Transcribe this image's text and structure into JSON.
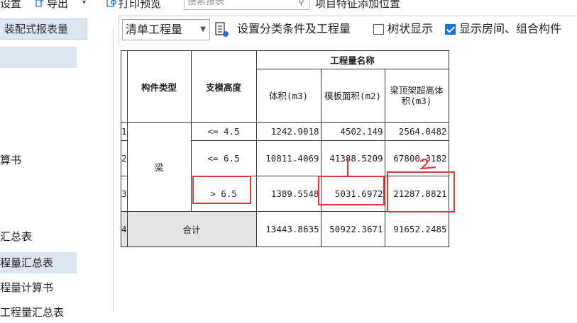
{
  "topbar": {
    "settings": "设置",
    "export": "导出",
    "print_preview": "打印预览",
    "search_placeholder": "搜索报表",
    "add_position": "项目特征添加位置"
  },
  "sidebar": {
    "tab_label": "装配式报表量",
    "items": [
      {
        "label": "算书"
      },
      {
        "label": "汇总表"
      },
      {
        "label": "程量汇总表"
      },
      {
        "label": "程量计算书"
      },
      {
        "label": "工程量汇总表"
      }
    ]
  },
  "toolbar": {
    "dropdown_value": "清单工程量",
    "set_classify": "设置分类条件及工程量",
    "tree_display": "树状显示",
    "tree_display_checked": false,
    "show_rooms": "显示房间、组合构件",
    "show_rooms_checked": true
  },
  "table": {
    "header_group": "工程量名称",
    "col_type": "构件类型",
    "col_height": "支模高度",
    "col_volume": "体积(m3)",
    "col_formwork": "模板面积(m2)",
    "col_beam": "梁顶架超高体积(m3)",
    "category": "梁",
    "rows": [
      {
        "no": "1",
        "height": "<= 4.5",
        "volume": "1242.9018",
        "formwork": "4502.149",
        "beam": "2564.0482"
      },
      {
        "no": "2",
        "height": "<= 6.5",
        "volume": "10811.4069",
        "formwork": "41388.5209",
        "beam": "67800.3182"
      },
      {
        "no": "3",
        "height": "> 6.5",
        "volume": "1389.5548",
        "formwork": "5031.6972",
        "beam": "21287.8821"
      }
    ],
    "total": {
      "no": "4",
      "label": "合计",
      "volume": "13443.8635",
      "formwork": "50922.3671",
      "beam": "91652.2485"
    }
  },
  "colors": {
    "highlight": "#e53935",
    "selected": "#dce6f1",
    "check": "#1e6fd9"
  }
}
